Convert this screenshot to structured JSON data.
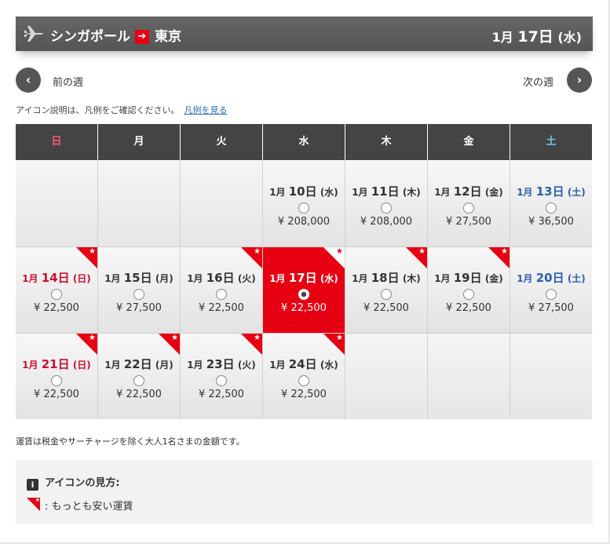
{
  "header": {
    "origin": "シンガポール",
    "arrow": "➔",
    "destination": "東京",
    "month": "1月",
    "day": "17日",
    "weekday": "(水)"
  },
  "nav": {
    "prev_label": "前の週",
    "next_label": "次の週",
    "prev_glyph": "‹",
    "next_glyph": "›"
  },
  "icon_note": {
    "text": "アイコン説明は、凡例をご確認ください。",
    "link": "凡例を見る"
  },
  "weekdays": [
    "日",
    "月",
    "火",
    "水",
    "木",
    "金",
    "土"
  ],
  "weeks": [
    [
      null,
      null,
      null,
      {
        "month": "1月",
        "day": "10日",
        "weekday": "(水)",
        "price": "¥ 208,000",
        "cheapest": false,
        "selected": false
      },
      {
        "month": "1月",
        "day": "11日",
        "weekday": "(木)",
        "price": "¥ 208,000",
        "cheapest": false,
        "selected": false
      },
      {
        "month": "1月",
        "day": "12日",
        "weekday": "(金)",
        "price": "¥ 27,500",
        "cheapest": false,
        "selected": false
      },
      {
        "month": "1月",
        "day": "13日",
        "weekday": "(土)",
        "price": "¥ 36,500",
        "cheapest": false,
        "selected": false
      }
    ],
    [
      {
        "month": "1月",
        "day": "14日",
        "weekday": "(日)",
        "price": "¥ 22,500",
        "cheapest": true,
        "selected": false
      },
      {
        "month": "1月",
        "day": "15日",
        "weekday": "(月)",
        "price": "¥ 27,500",
        "cheapest": false,
        "selected": false
      },
      {
        "month": "1月",
        "day": "16日",
        "weekday": "(火)",
        "price": "¥ 22,500",
        "cheapest": true,
        "selected": false
      },
      {
        "month": "1月",
        "day": "17日",
        "weekday": "(水)",
        "price": "¥ 22,500",
        "cheapest": true,
        "selected": true
      },
      {
        "month": "1月",
        "day": "18日",
        "weekday": "(木)",
        "price": "¥ 22,500",
        "cheapest": true,
        "selected": false
      },
      {
        "month": "1月",
        "day": "19日",
        "weekday": "(金)",
        "price": "¥ 22,500",
        "cheapest": true,
        "selected": false
      },
      {
        "month": "1月",
        "day": "20日",
        "weekday": "(土)",
        "price": "¥ 27,500",
        "cheapest": false,
        "selected": false
      }
    ],
    [
      {
        "month": "1月",
        "day": "21日",
        "weekday": "(日)",
        "price": "¥ 22,500",
        "cheapest": true,
        "selected": false
      },
      {
        "month": "1月",
        "day": "22日",
        "weekday": "(月)",
        "price": "¥ 22,500",
        "cheapest": true,
        "selected": false
      },
      {
        "month": "1月",
        "day": "23日",
        "weekday": "(火)",
        "price": "¥ 22,500",
        "cheapest": true,
        "selected": false
      },
      {
        "month": "1月",
        "day": "24日",
        "weekday": "(水)",
        "price": "¥ 22,500",
        "cheapest": true,
        "selected": false
      },
      null,
      null,
      null
    ]
  ],
  "fare_note": "運賃は税金やサーチャージを除く大人1名さまの金額です。",
  "legend": {
    "title": "アイコンの見方:",
    "item": ": もっとも安い運賃"
  },
  "colors": {
    "accent": "#e60012",
    "header_bg": "#555555",
    "sunday": "#c8102e",
    "saturday": "#2a5fb0"
  },
  "icons": {
    "plane": "plane-icon",
    "star": "★",
    "info": "i"
  }
}
